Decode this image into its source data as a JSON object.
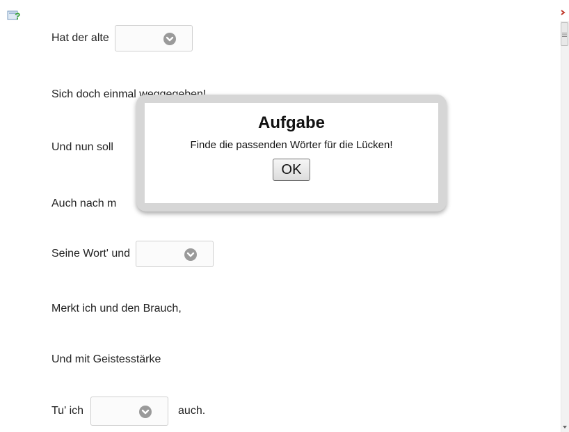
{
  "lines": {
    "l1": "Hat der alte",
    "l2": "Sich doch einmal weggegeben!",
    "l3": "Und nun soll",
    "l4": "Auch nach m",
    "l5": "Seine Wort' und",
    "l6": "Merkt ich und den Brauch,",
    "l7": "Und mit Geistesstärke",
    "l8_prefix": "Tu' ich",
    "l8_suffix": "auch."
  },
  "dropdowns": {
    "gap1": "",
    "gap2": "",
    "gap3": ""
  },
  "dialog": {
    "title": "Aufgabe",
    "message": "Finde die passenden Wörter für die Lücken!",
    "ok_label": "OK"
  },
  "colors": {
    "dialog_frame": "#d6d6d6",
    "chevron_circle": "#9a9a9a",
    "help_icon_green": "#3aa43a"
  },
  "icons": {
    "help": "help-icon",
    "chevron": "chevron-down-icon",
    "scroll_up": "scroll-up-arrow-icon",
    "scroll_down": "scroll-down-arrow-icon"
  }
}
